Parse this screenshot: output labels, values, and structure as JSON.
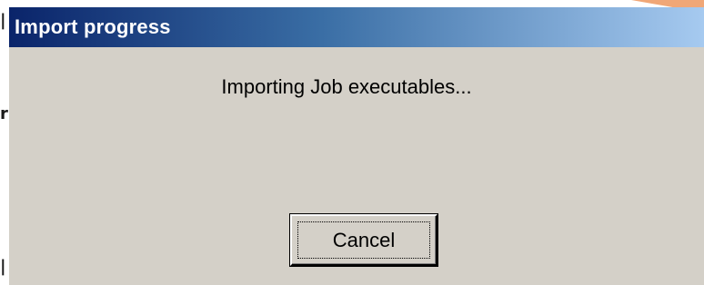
{
  "dialog": {
    "title": "Import progress",
    "status": "Importing Job executables...",
    "cancel_label": "Cancel"
  },
  "colors": {
    "titlebar_start": "#0a246a",
    "titlebar_end": "#a6caf0",
    "dialog_face": "#d4d0c8"
  }
}
